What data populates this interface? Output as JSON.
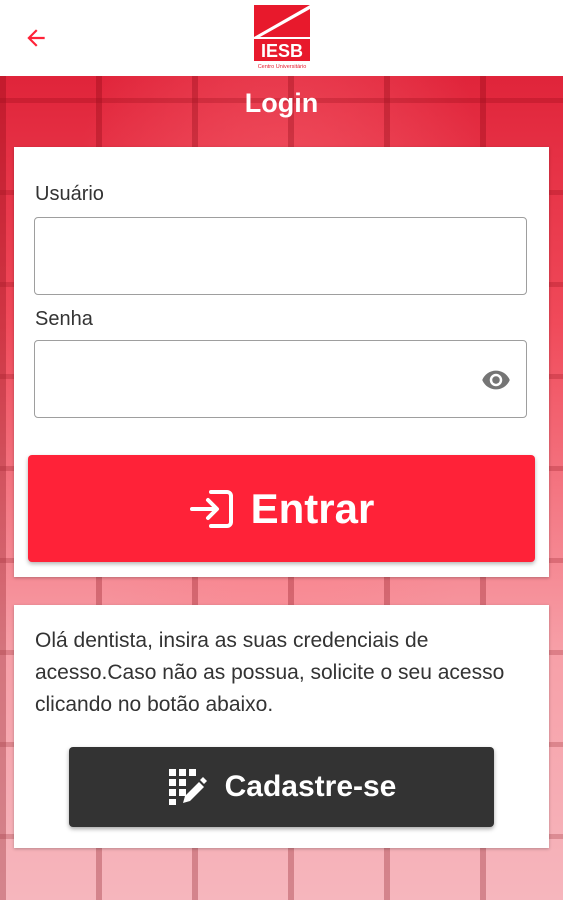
{
  "header": {
    "back_icon": "arrow-left-icon",
    "logo_text": "IESB",
    "logo_subtext": "Centro Universitário",
    "accent_color": "#ff2238"
  },
  "page": {
    "title": "Login"
  },
  "login_form": {
    "username_label": "Usuário",
    "username_value": "",
    "password_label": "Senha",
    "password_value": "",
    "password_visibility_icon": "eye-icon",
    "submit_icon": "login-icon",
    "submit_label": "Entrar"
  },
  "info": {
    "message": "Olá dentista, insira as suas credenciais de acesso.Caso não as possua, solicite o seu acesso clicando no botão abaixo.",
    "register_icon": "register-edit-icon",
    "register_label": "Cadastre-se",
    "register_color": "#333333"
  }
}
